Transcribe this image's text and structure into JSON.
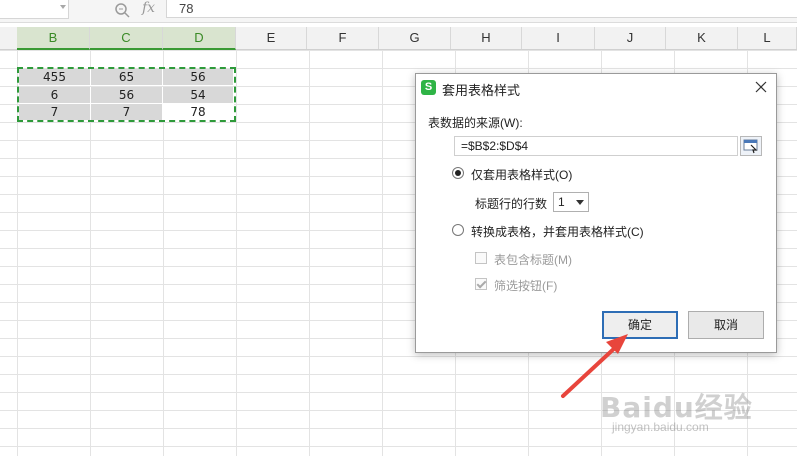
{
  "formula_bar": {
    "fx_label": "fx",
    "value": "78"
  },
  "columns": [
    "B",
    "C",
    "D",
    "E",
    "F",
    "G",
    "H",
    "I",
    "J",
    "K",
    "L"
  ],
  "selected_columns": [
    "B",
    "C",
    "D"
  ],
  "cells": [
    [
      "455",
      "65",
      "56"
    ],
    [
      "6",
      "56",
      "54"
    ],
    [
      "7",
      "7",
      "78"
    ]
  ],
  "dialog": {
    "app_icon_letter": "S",
    "title": "套用表格样式",
    "source_label": "表数据的来源(W):",
    "source_value": "=$B$2:$D$4",
    "option_style_only": "仅套用表格样式(O)",
    "header_rows_label": "标题行的行数",
    "header_rows_value": "1",
    "option_convert": "转换成表格，并套用表格样式(C)",
    "checkbox_has_headers": "表包含标题(M)",
    "checkbox_filter": "筛选按钮(F)",
    "ok_label": "确定",
    "cancel_label": "取消"
  },
  "watermark": {
    "brand": "Baidu经验",
    "sub": "jingyan.baidu.com"
  },
  "colors": {
    "selection": "#2e9a3a",
    "selected_header": "#d9e4cf",
    "arrow": "#e8453c",
    "primary_border": "#2d6db5"
  }
}
